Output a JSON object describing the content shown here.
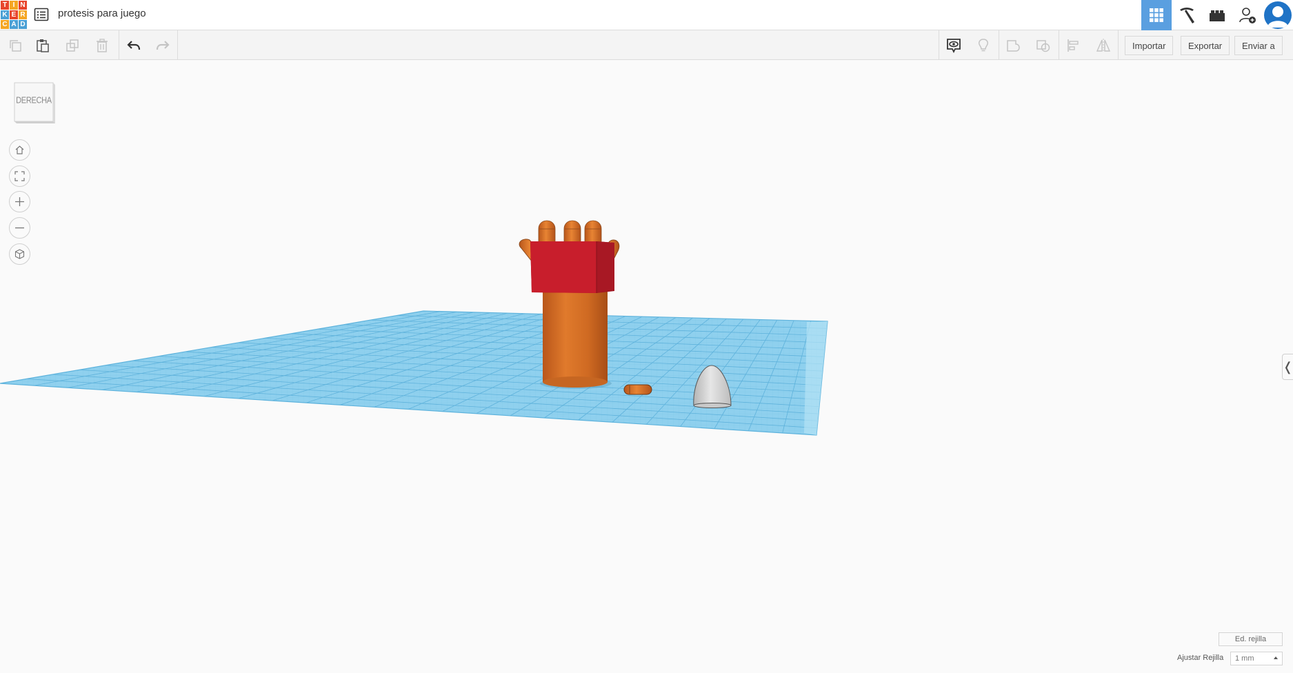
{
  "app": {
    "logo_letters": [
      "T",
      "I",
      "N",
      "K",
      "E",
      "R",
      "C",
      "A",
      "D"
    ],
    "logo_colors": [
      "#e8452c",
      "#f5a623",
      "#e8452c",
      "#4aa0d5",
      "#e8452c",
      "#f5a623",
      "#f5a623",
      "#4aa0d5",
      "#4aa0d5"
    ],
    "project_title": "protesis para juego"
  },
  "top_toolbar": {
    "icons": [
      "3d-view-grid-icon",
      "pickaxe-icon",
      "bricks-icon",
      "add-user-icon",
      "avatar"
    ],
    "active": "3d-view-grid-icon"
  },
  "edit_toolbar": {
    "import_label": "Importar",
    "export_label": "Exportar",
    "send_label": "Enviar a"
  },
  "viewcube": {
    "face_label": "DERECHA"
  },
  "bottom_right": {
    "edit_grid_label": "Ed. rejilla",
    "snap_label": "Ajustar Rejilla",
    "snap_value": "1 mm"
  },
  "colors": {
    "workplane": "#7ec7e8",
    "grid_line": "#5ab0d8",
    "orange": "#d9742a",
    "red": "#c81e2c",
    "grey_shape": "#d8d8d8",
    "active_tab": "#5a9fe0"
  }
}
